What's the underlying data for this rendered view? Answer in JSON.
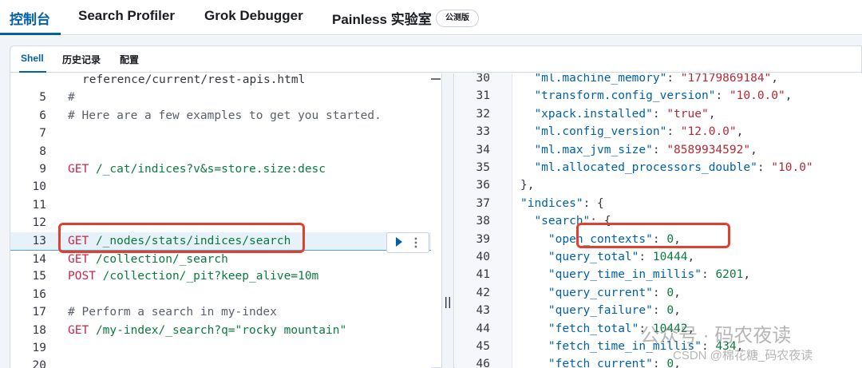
{
  "app_tabs": [
    {
      "label": "控制台",
      "active": true
    },
    {
      "label": "Search Profiler",
      "active": false
    },
    {
      "label": "Grok Debugger",
      "active": false
    },
    {
      "label": "Painless 实验室",
      "active": false
    }
  ],
  "beta_badge": "公测版",
  "sub_tabs": [
    {
      "label": "Shell",
      "active": true
    },
    {
      "label": "历史记录",
      "active": false
    },
    {
      "label": "配置",
      "active": false
    }
  ],
  "editor": {
    "lines": [
      {
        "num": "",
        "text": "reference/current/rest-apis.html"
      },
      {
        "num": "5",
        "text": "#"
      },
      {
        "num": "6",
        "text": "# Here are a few examples to get you started."
      },
      {
        "num": "7",
        "text": ""
      },
      {
        "num": "8",
        "text": ""
      },
      {
        "num": "9",
        "method": "GET",
        "path": "/_cat/indices?v&s=store.size:desc"
      },
      {
        "num": "10",
        "text": ""
      },
      {
        "num": "11",
        "text": ""
      },
      {
        "num": "12",
        "text": ""
      },
      {
        "num": "13",
        "method": "GET",
        "path": "/_nodes/stats/indices/search"
      },
      {
        "num": "14",
        "method": "GET",
        "path": "/collection/_search"
      },
      {
        "num": "15",
        "method": "POST",
        "path": "/collection/_pit?keep_alive=10m"
      },
      {
        "num": "16",
        "text": ""
      },
      {
        "num": "17",
        "text": "# Perform a search in my-index"
      },
      {
        "num": "18",
        "method": "GET",
        "path": "/my-index/_search?q=\"rocky mountain\""
      },
      {
        "num": "19",
        "text": ""
      },
      {
        "num": "20",
        "text": ""
      }
    ]
  },
  "output": {
    "lines": [
      {
        "num": "30",
        "indent": 10,
        "key": "\"ml.machine_memory\"",
        "value": "\"17179869184\"",
        "vtype": "str",
        "trail": ","
      },
      {
        "num": "31",
        "indent": 10,
        "key": "\"transform.config_version\"",
        "value": "\"10.0.0\"",
        "vtype": "str",
        "trail": ","
      },
      {
        "num": "32",
        "indent": 10,
        "key": "\"xpack.installed\"",
        "value": "\"true\"",
        "vtype": "str",
        "trail": ","
      },
      {
        "num": "33",
        "indent": 10,
        "key": "\"ml.config_version\"",
        "value": "\"12.0.0\"",
        "vtype": "str",
        "trail": ","
      },
      {
        "num": "34",
        "indent": 10,
        "key": "\"ml.max_jvm_size\"",
        "value": "\"8589934592\"",
        "vtype": "str",
        "trail": ","
      },
      {
        "num": "35",
        "indent": 10,
        "key": "\"ml.allocated_processors_double\"",
        "value": "\"10.0\"",
        "vtype": "str",
        "trail": ""
      },
      {
        "num": "36",
        "indent": 8,
        "punc": "},"
      },
      {
        "num": "37",
        "indent": 8,
        "key": "\"indices\"",
        "punc_after": ": {"
      },
      {
        "num": "38",
        "indent": 10,
        "key": "\"search\"",
        "punc_after": ": {"
      },
      {
        "num": "39",
        "indent": 12,
        "key": "\"open_contexts\"",
        "value": "0",
        "vtype": "num",
        "trail": ","
      },
      {
        "num": "40",
        "indent": 12,
        "key": "\"query_total\"",
        "value": "10444",
        "vtype": "num",
        "trail": ","
      },
      {
        "num": "41",
        "indent": 12,
        "key": "\"query_time_in_millis\"",
        "value": "6201",
        "vtype": "num",
        "trail": ","
      },
      {
        "num": "42",
        "indent": 12,
        "key": "\"query_current\"",
        "value": "0",
        "vtype": "num",
        "trail": ","
      },
      {
        "num": "43",
        "indent": 12,
        "key": "\"query_failure\"",
        "value": "0",
        "vtype": "num",
        "trail": ","
      },
      {
        "num": "44",
        "indent": 12,
        "key": "\"fetch_total\"",
        "value": "10442",
        "vtype": "num",
        "trail": ","
      },
      {
        "num": "45",
        "indent": 12,
        "key": "\"fetch_time_in_millis\"",
        "value": "434",
        "vtype": "num",
        "trail": ","
      },
      {
        "num": "46",
        "indent": 12,
        "key": "\"fetch_current\"",
        "value": "0",
        "vtype": "num",
        "trail": ","
      }
    ]
  },
  "watermark": {
    "line1": "公众号 · 码农夜读",
    "line2": "CSDN @棉花糖_码农夜读"
  },
  "colors": {
    "accent": "#0061a6",
    "annotation": "#e0412f",
    "method": "#c7264a",
    "path": "#0b7a3e"
  }
}
